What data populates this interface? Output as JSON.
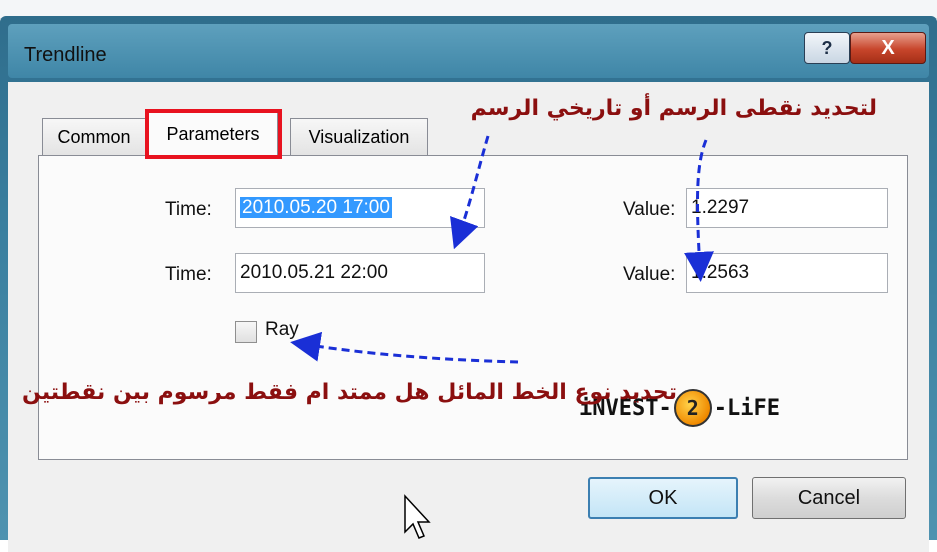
{
  "dialog": {
    "title": "Trendline",
    "help_glyph": "?",
    "close_glyph": "X"
  },
  "tabs": [
    {
      "label": "Common",
      "active": false
    },
    {
      "label": "Parameters",
      "active": true
    },
    {
      "label": "Visualization",
      "active": false
    }
  ],
  "params": {
    "time1_label": "Time:",
    "time1_value": "2010.05.20 17:00",
    "time2_label": "Time:",
    "time2_value": "2010.05.21 22:00",
    "value1_label": "Value:",
    "value1_value": "1.2297",
    "value2_label": "Value:",
    "value2_value": "1.2563",
    "ray_label": "Ray",
    "ray_checked": false
  },
  "buttons": {
    "ok": "OK",
    "cancel": "Cancel"
  },
  "annotations": {
    "top_right": "لتحديد نقطى الرسم أو تاريخي الرسم",
    "bottom": "تحديد نوع الخط المائل هل ممتد ام فقط مرسوم بين نقطتين",
    "highlight_color": "#e8121f",
    "arrow_color": "#1a2fd6",
    "text_color": "#8b0f0f"
  },
  "logo": {
    "left": "iNVEST-",
    "middle": "2",
    "right": "-LiFE"
  }
}
